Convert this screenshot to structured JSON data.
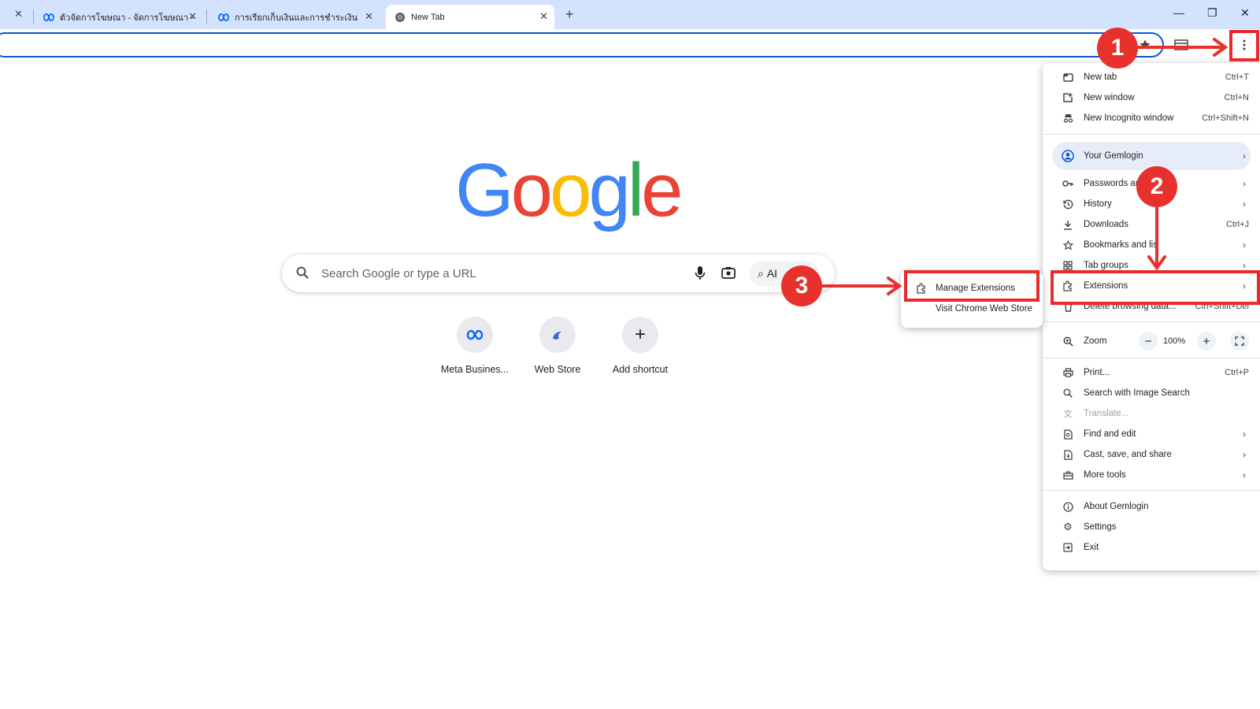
{
  "tabs": [
    {
      "title": "ตัวจัดการโฆษณา - จัดการโฆษณา - ",
      "icon": "meta-icon",
      "active": false
    },
    {
      "title": "การเรียกเก็บเงินและการชำระเงิน",
      "icon": "meta-icon",
      "active": false
    },
    {
      "title": "New Tab",
      "icon": "chrome-icon",
      "active": true
    }
  ],
  "window_controls": {
    "minimize": "—",
    "restore": "❐",
    "close": "✕",
    "new_tab": "+",
    "first_close": "✕"
  },
  "google": {
    "logo_letters": [
      "G",
      "o",
      "o",
      "g",
      "l",
      "e"
    ],
    "logo_colors": [
      "#4285f4",
      "#ea4335",
      "#fbbc05",
      "#4285f4",
      "#34a853",
      "#ea4335"
    ],
    "search_placeholder": "Search Google or type a URL",
    "ai_mode_label": "AI"
  },
  "shortcuts": [
    {
      "label": "Meta Busines...",
      "icon": "meta-icon"
    },
    {
      "label": "Web Store",
      "icon": "webstore-icon"
    },
    {
      "label": "Add shortcut",
      "icon": "plus-icon"
    }
  ],
  "menu": {
    "new_tab": {
      "label": "New tab",
      "shortcut": "Ctrl+T"
    },
    "new_window": {
      "label": "New window",
      "shortcut": "Ctrl+N"
    },
    "new_incognito": {
      "label": "New Incognito window",
      "shortcut": "Ctrl+Shift+N"
    },
    "profile": {
      "label": "Your Gemlogin"
    },
    "passwords": {
      "label": "Passwords an"
    },
    "history": {
      "label": "History"
    },
    "downloads": {
      "label": "Downloads",
      "shortcut": "Ctrl+J"
    },
    "bookmarks": {
      "label": "Bookmarks and lis"
    },
    "tab_groups": {
      "label": "Tab groups"
    },
    "extensions": {
      "label": "Extensions"
    },
    "delete_data": {
      "label": "Delete browsing data...",
      "shortcut": "Ctrl+Shift+Del"
    },
    "zoom": {
      "label": "Zoom",
      "value": "100%",
      "minus": "−",
      "plus": "+"
    },
    "print": {
      "label": "Print...",
      "shortcut": "Ctrl+P"
    },
    "image_search": {
      "label": "Search with Image Search"
    },
    "translate": {
      "label": "Translate..."
    },
    "find_edit": {
      "label": "Find and edit"
    },
    "cast_save": {
      "label": "Cast, save, and share"
    },
    "more_tools": {
      "label": "More tools"
    },
    "about": {
      "label": "About Gemlogin"
    },
    "settings": {
      "label": "Settings"
    },
    "exit": {
      "label": "Exit"
    }
  },
  "submenu": {
    "manage_extensions": "Manage Extensions",
    "visit_store": "Visit Chrome Web Store"
  },
  "annotations": {
    "step1": "1",
    "step2": "2",
    "step3": "3",
    "color": "#e8302c"
  }
}
